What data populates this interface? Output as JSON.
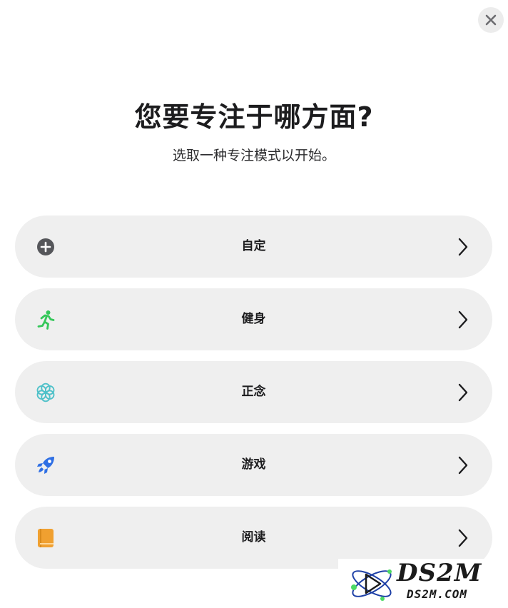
{
  "header": {
    "title": "您要专注于哪方面?",
    "subtitle": "选取一种专注模式以开始。"
  },
  "close_icon": "xmark-icon",
  "options": [
    {
      "label": "自定",
      "icon": "plus-circle-icon",
      "icon_color": "#5a5a5e"
    },
    {
      "label": "健身",
      "icon": "running-figure-icon",
      "icon_color": "#34c759"
    },
    {
      "label": "正念",
      "icon": "flower-icon",
      "icon_color": "#4fc1c9"
    },
    {
      "label": "游戏",
      "icon": "rocket-icon",
      "icon_color": "#2f6fe4"
    },
    {
      "label": "阅读",
      "icon": "book-icon",
      "icon_color": "#f0a030"
    }
  ],
  "watermark": {
    "logo": "DS2M",
    "site": "DS2M.COM"
  }
}
